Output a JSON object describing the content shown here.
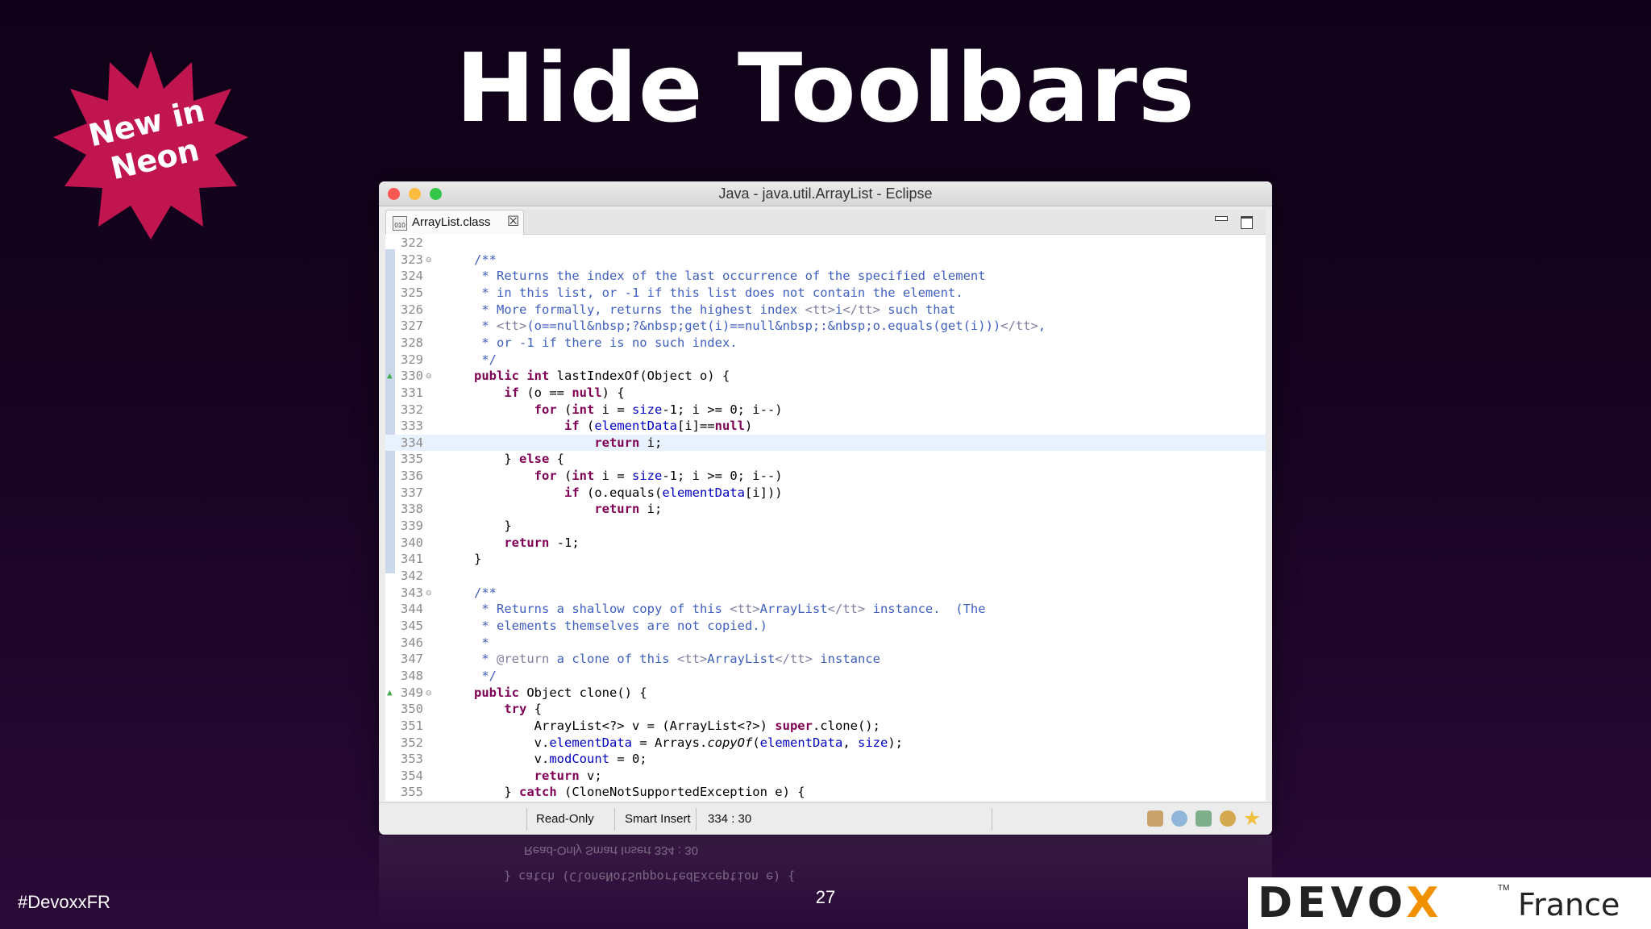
{
  "slide": {
    "title": "Hide Toolbars",
    "badge_line1": "New in",
    "badge_line2": "Neon",
    "hashtag": "#DevoxxFR",
    "page_number": "27",
    "logo_main_pre": "DEVO",
    "logo_main_x": "X",
    "logo_tm": "TM",
    "logo_sub": "France"
  },
  "window": {
    "title": "Java - java.util.ArrayList - Eclipse",
    "tab_label": "ArrayList.class",
    "tab_icon_text": "010",
    "tab_close": "☒"
  },
  "editor": {
    "current_line": "334",
    "lines": [
      {
        "n": "322",
        "text": ""
      },
      {
        "n": "323",
        "text": "/**",
        "fold": "⊖"
      },
      {
        "n": "324",
        "text": " * Returns the index of the last occurrence of the specified element"
      },
      {
        "n": "325",
        "text": " * in this list, or -1 if this list does not contain the element."
      },
      {
        "n": "326",
        "text": " * More formally, returns the highest index <tt>i</tt> such that"
      },
      {
        "n": "327",
        "text": " * <tt>(o==null&nbsp;?&nbsp;get(i)==null&nbsp;:&nbsp;o.equals(get(i)))</tt>,"
      },
      {
        "n": "328",
        "text": " * or -1 if there is no such index."
      },
      {
        "n": "329",
        "text": " */"
      },
      {
        "n": "330",
        "text": "public int lastIndexOf(Object o) {",
        "fold": "⊖",
        "marker": "▲"
      },
      {
        "n": "331",
        "text": "    if (o == null) {"
      },
      {
        "n": "332",
        "text": "        for (int i = size-1; i >= 0; i--)"
      },
      {
        "n": "333",
        "text": "            if (elementData[i]==null)"
      },
      {
        "n": "334",
        "text": "                return i;"
      },
      {
        "n": "335",
        "text": "    } else {"
      },
      {
        "n": "336",
        "text": "        for (int i = size-1; i >= 0; i--)"
      },
      {
        "n": "337",
        "text": "            if (o.equals(elementData[i]))"
      },
      {
        "n": "338",
        "text": "                return i;"
      },
      {
        "n": "339",
        "text": "    }"
      },
      {
        "n": "340",
        "text": "    return -1;"
      },
      {
        "n": "341",
        "text": "}"
      },
      {
        "n": "342",
        "text": ""
      },
      {
        "n": "343",
        "text": "/**",
        "fold": "⊖"
      },
      {
        "n": "344",
        "text": " * Returns a shallow copy of this <tt>ArrayList</tt> instance.  (The"
      },
      {
        "n": "345",
        "text": " * elements themselves are not copied.)"
      },
      {
        "n": "346",
        "text": " *"
      },
      {
        "n": "347",
        "text": " * @return a clone of this <tt>ArrayList</tt> instance"
      },
      {
        "n": "348",
        "text": " */"
      },
      {
        "n": "349",
        "text": "public Object clone() {",
        "fold": "⊖",
        "marker": "▲"
      },
      {
        "n": "350",
        "text": "    try {"
      },
      {
        "n": "351",
        "text": "        ArrayList<?> v = (ArrayList<?>) super.clone();"
      },
      {
        "n": "352",
        "text": "        v.elementData = Arrays.copyOf(elementData, size);"
      },
      {
        "n": "353",
        "text": "        v.modCount = 0;"
      },
      {
        "n": "354",
        "text": "        return v;"
      },
      {
        "n": "355",
        "text": "    } catch (CloneNotSupportedException e) {"
      }
    ]
  },
  "status": {
    "read_only": "Read-Only",
    "insert_mode": "Smart Insert",
    "position": "334 : 30"
  },
  "reflection": {
    "status_text": "Read-Only        Smart Insert      334 : 30",
    "code_text": "} catch (CloneNotSupportedException e) {"
  },
  "colors": {
    "background": "#16031f",
    "badge": "#c0154f",
    "accent_logo": "#f29100"
  },
  "trim_icons": [
    "package-icon",
    "globe-icon",
    "image-icon",
    "team-icon",
    "star-icon"
  ]
}
